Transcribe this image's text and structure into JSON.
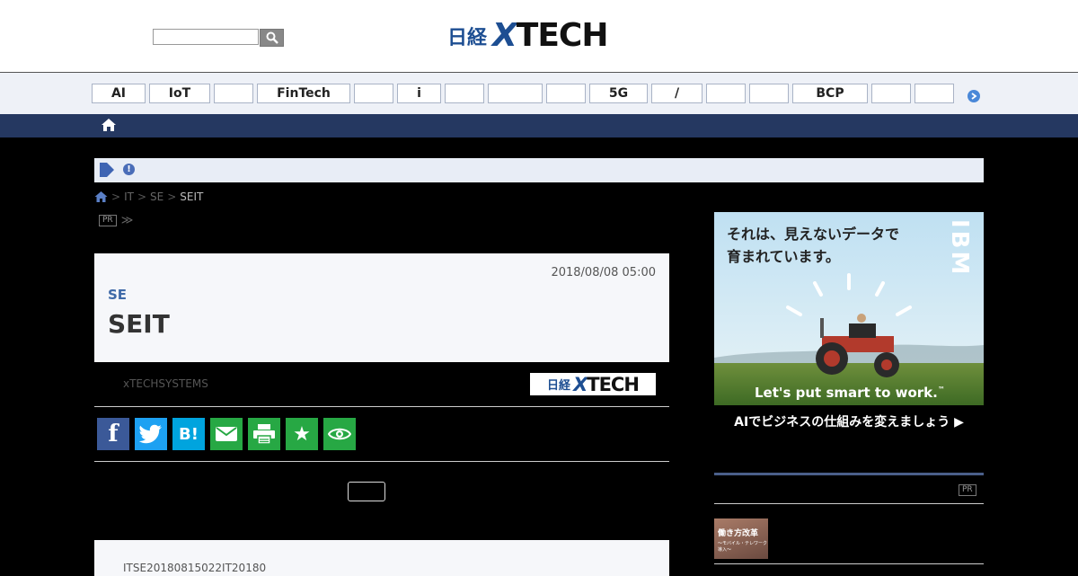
{
  "header": {
    "search": {
      "placeholder": "",
      "button_icon": "search-icon"
    },
    "logo": {
      "nikkei": "日経",
      "xtech": "TECH",
      "x": "X"
    }
  },
  "tagnav": {
    "tags": [
      "AI",
      "IoT",
      "",
      "FinTech",
      "",
      "i",
      "",
      "",
      "",
      "5G",
      "/",
      "",
      "",
      "BCP",
      "",
      ""
    ],
    "next_icon": "chevron-right-icon"
  },
  "subnav": {
    "home_icon": "home-icon"
  },
  "notice": {
    "play_icon": "play-icon",
    "alert_icon": "alert-icon",
    "alert_symbol": "!"
  },
  "breadcrumb": {
    "home_icon": "home-icon",
    "items": [
      "IT",
      "SE"
    ],
    "current": "SEIT",
    "separator": ">"
  },
  "pr_line": {
    "badge": "PR",
    "more": "≫"
  },
  "article": {
    "date": "2018/08/08 05:00",
    "kicker": "SE",
    "title": "SEIT",
    "byline": "xTECHSYSTEMS",
    "body_start": "ITSE20180815022IT20180"
  },
  "share": [
    {
      "name": "facebook",
      "glyph": "f",
      "color": "#3b5998"
    },
    {
      "name": "twitter",
      "glyph": "",
      "color": "#1da1f2"
    },
    {
      "name": "hatena",
      "glyph": "B!",
      "color": "#00a4de"
    },
    {
      "name": "mail",
      "glyph": "",
      "color": "#27a844"
    },
    {
      "name": "print",
      "glyph": "",
      "color": "#27a844"
    },
    {
      "name": "bookmark",
      "glyph": "★",
      "color": "#27a844"
    },
    {
      "name": "watch",
      "glyph": "",
      "color": "#27a844"
    }
  ],
  "follow_button": "",
  "ad": {
    "headline_line1": "それは、見えないデータで",
    "headline_line2": "育まれています。",
    "brand": "IBM",
    "tagline": "Let's put smart to work.",
    "tm": "™",
    "cta": "AIでビジネスの仕組みを変えましょう ▶"
  },
  "pr_section": {
    "badge": "PR",
    "thumb_line1": "働き方改革",
    "thumb_line2": "～モバイル・テレワーク導入～"
  }
}
